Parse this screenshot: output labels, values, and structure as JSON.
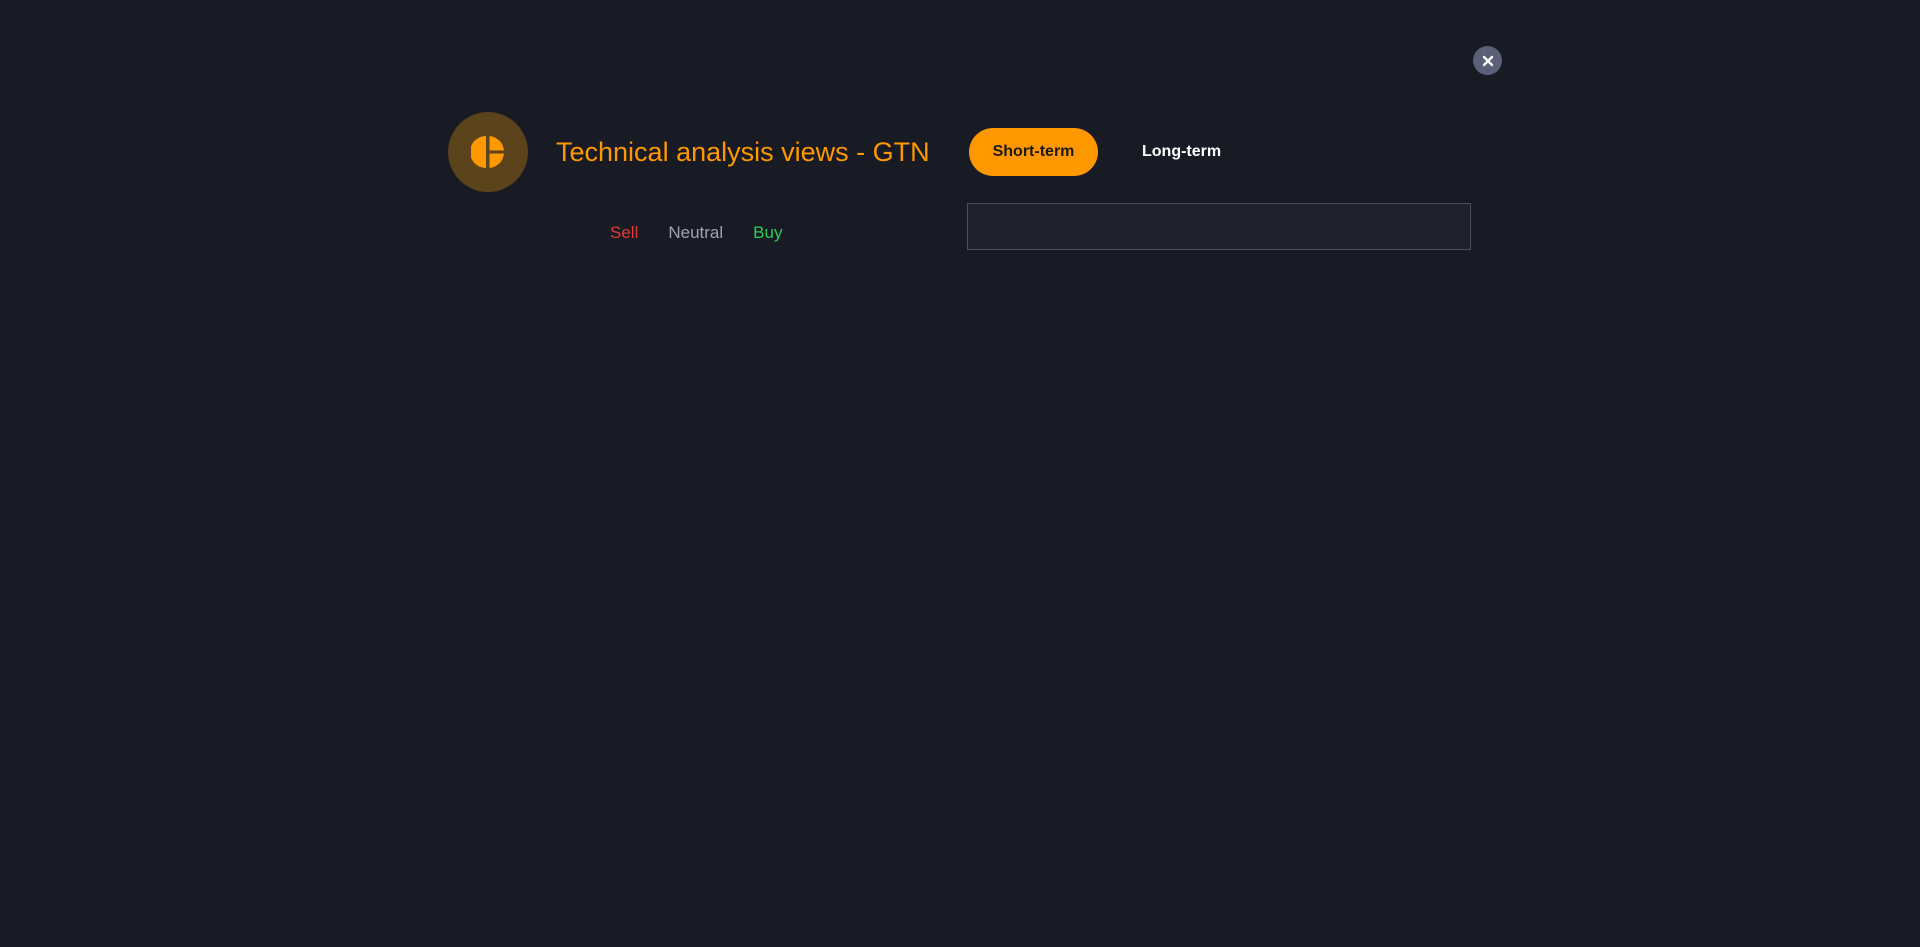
{
  "dialog": {
    "title": "Technical analysis views - GTN",
    "close_icon": "close-icon",
    "logo_icon": "pie-chart-icon"
  },
  "tabs": [
    {
      "label": "Short-term",
      "active": true
    },
    {
      "label": "Long-term",
      "active": false
    }
  ],
  "legend": {
    "sell": "Sell",
    "neutral": "Neutral",
    "buy": "Buy"
  },
  "colors": {
    "accent": "#ff9800",
    "sell": "#e53935",
    "neutral": "#9ea3ad",
    "buy": "#2ecc55",
    "background": "#181b24"
  }
}
